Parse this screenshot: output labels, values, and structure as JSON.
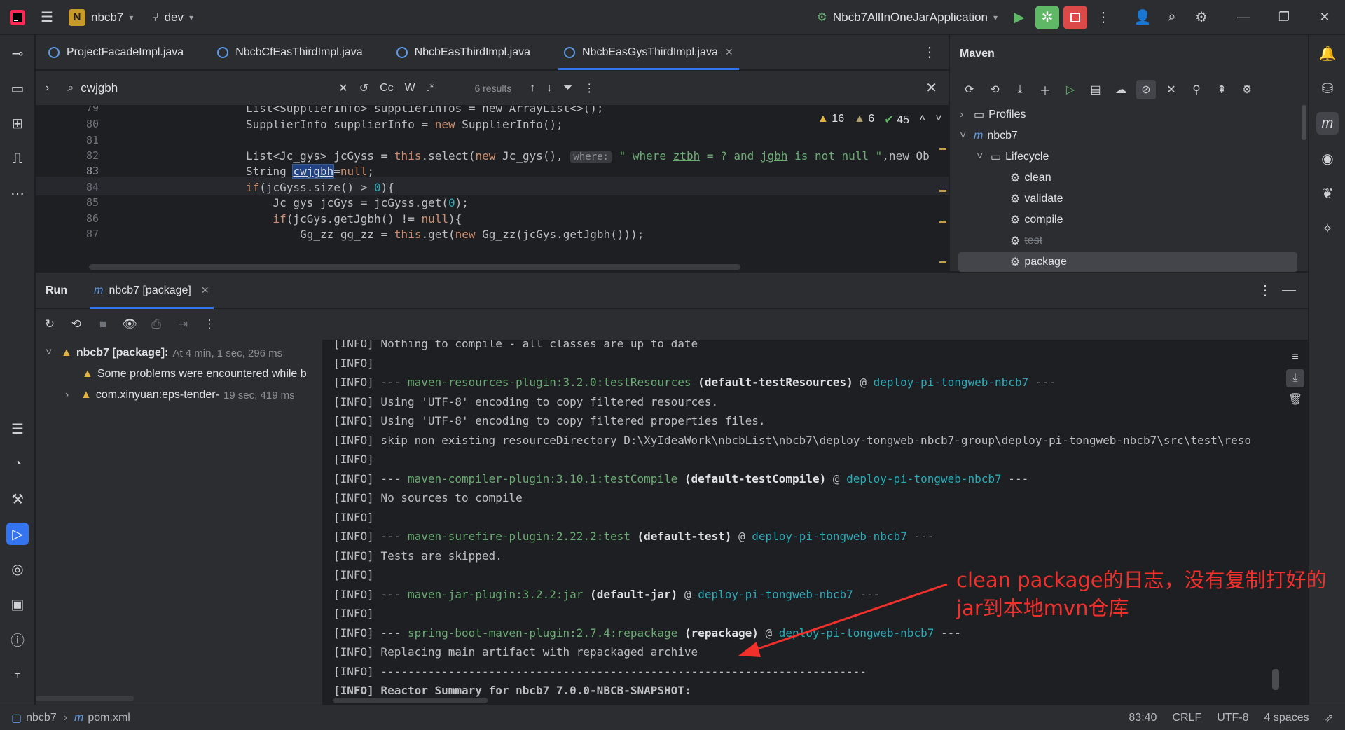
{
  "titlebar": {
    "project": "nbcb7",
    "project_badge": "N",
    "branch": "dev",
    "run_config": "Nbcb7AllInOneJarApplication"
  },
  "editor_tabs": [
    {
      "label": "ProjectFacadeImpl.java"
    },
    {
      "label": "NbcbCfEasThirdImpl.java"
    },
    {
      "label": "NbcbEasThirdImpl.java"
    },
    {
      "label": "NbcbEasGysThirdImpl.java",
      "active": true
    }
  ],
  "find": {
    "query": "cwjgbh",
    "case_label": "Cc",
    "word_label": "W",
    "regex_label": ".*",
    "results": "6 results"
  },
  "inspections": {
    "warnings": "16",
    "weak_warnings": "6",
    "ok": "45"
  },
  "code": {
    "line_numbers": [
      "79",
      "80",
      "81",
      "82",
      "83",
      "84",
      "85",
      "86",
      "87"
    ],
    "l79": "List<SupplierInfo> supplierInfos = new ArrayList<>();",
    "l80a": "SupplierInfo supplierInfo = ",
    "l80b": "new",
    "l80c": " SupplierInfo();",
    "l82a": "List<Jc_gys> jcGyss = ",
    "l82b": "this",
    "l82c": ".select(",
    "l82d": "new",
    "l82e": " Jc_gys(), ",
    "l82hint": "where:",
    "l82f": " \" where ",
    "l82g": "ztbh",
    "l82h": " = ? and ",
    "l82i": "jgbh",
    "l82j": " is not null \"",
    "l82k": ",new Ob",
    "l83a": "String ",
    "l83b": "cwjgbh",
    "l83c": "=",
    "l83d": "null",
    "l83e": ";",
    "l84a": "if",
    "l84b": "(jcGyss.size() > ",
    "l84c": "0",
    "l84d": "){",
    "l85a": "    Jc_gys jcGys = jcGyss.get(",
    "l85b": "0",
    "l85c": ");",
    "l86a": "    ",
    "l86b": "if",
    "l86c": "(jcGys.getJgbh() != ",
    "l86d": "null",
    "l86e": "){",
    "l87a": "        Gg_zz gg_zz = ",
    "l87b": "this",
    "l87c": ".get(",
    "l87d": "new",
    "l87e": " Gg_zz(jcGys.getJgbh()));"
  },
  "maven": {
    "title": "Maven",
    "tree": {
      "profiles": "Profiles",
      "project": "nbcb7",
      "lifecycle": "Lifecycle",
      "phases": [
        "clean",
        "validate",
        "compile",
        "test",
        "package"
      ]
    }
  },
  "run": {
    "tab_run": "Run",
    "tab_config": "nbcb7 [package]",
    "tree": {
      "root_label": "nbcb7 [package]:",
      "root_time": "At  4 min, 1 sec, 296 ms",
      "problem": "Some problems were encountered while b",
      "module": "com.xinyuan:eps-tender-",
      "module_time": "19 sec, 419 ms"
    }
  },
  "console": {
    "tag": "[INFO]",
    "lines": {
      "c1": " Nothing to compile - all classes are up to date",
      "c3a": " --- ",
      "c3p": "maven-resources-plugin:3.2.0:testResources",
      "c3b": " (default-testResources)",
      "c3c": " @ ",
      "c3d": "deploy-pi-tongweb-nbcb7",
      "c3e": " ---",
      "c4": " Using 'UTF-8' encoding to copy filtered resources.",
      "c5": " Using 'UTF-8' encoding to copy filtered properties files.",
      "c6": " skip non existing resourceDirectory D:\\XyIdeaWork\\nbcbList\\nbcb7\\deploy-tongweb-nbcb7-group\\deploy-pi-tongweb-nbcb7\\src\\test\\reso",
      "c8p": "maven-compiler-plugin:3.10.1:testCompile",
      "c8b": " (default-testCompile)",
      "c9": " No sources to compile",
      "c11p": "maven-surefire-plugin:2.22.2:test",
      "c11b": " (default-test)",
      "c12": " Tests are skipped.",
      "c14p": "maven-jar-plugin:3.2.2:jar",
      "c14b": " (default-jar)",
      "c16p": "spring-boot-maven-plugin:2.7.4:repackage",
      "c16b": " (repackage)",
      "c17": " Replacing main artifact with repackaged archive",
      "c18": " ------------------------------------------------------------------------",
      "c19": " Reactor Summary for nbcb7 7.0.0-NBCB-SNAPSHOT:"
    }
  },
  "annotation": "clean package的日志，没有复制打好的jar到本地mvn仓库",
  "statusbar": {
    "project": "nbcb7",
    "file": "pom.xml",
    "position": "83:40",
    "line_sep": "CRLF",
    "encoding": "UTF-8",
    "indent": "4 spaces"
  }
}
